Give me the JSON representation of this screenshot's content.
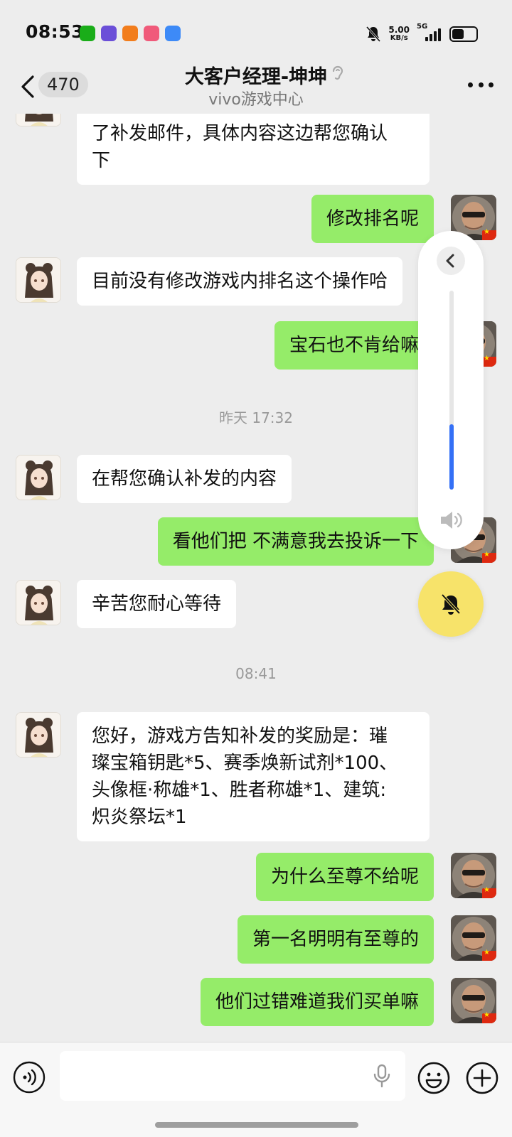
{
  "status_bar": {
    "time": "08:53",
    "net_speed_value": "5.00",
    "net_speed_unit": "KB/s",
    "network": "5G",
    "app_icons": [
      "wechat-icon",
      "sports-app-icon",
      "orange-app-icon",
      "video-app-icon",
      "browser-app-icon"
    ],
    "app_colors": [
      "#1aad19",
      "#6b4fd8",
      "#f27d1c",
      "#f05a7a",
      "#3d8af7"
    ]
  },
  "header": {
    "back_count": "470",
    "title": "大客户经理-坤坤",
    "subtitle": "vivo游戏中心"
  },
  "messages": [
    {
      "side": "in",
      "text": "了补发邮件，具体内容这边帮您确认\n下"
    },
    {
      "side": "out",
      "text": "修改排名呢"
    },
    {
      "side": "in",
      "text": "目前没有修改游戏内排名这个操作哈"
    },
    {
      "side": "out",
      "text": "宝石也不肯给嘛"
    },
    {
      "side": "time",
      "text": "昨天 17:32"
    },
    {
      "side": "in",
      "text": "在帮您确认补发的内容"
    },
    {
      "side": "out",
      "text": "看他们把 不满意我去投诉一下"
    },
    {
      "side": "in",
      "text": "辛苦您耐心等待"
    },
    {
      "side": "time",
      "text": "08:41"
    },
    {
      "side": "in",
      "text": "您好，游戏方告知补发的奖励是：璀\n璨宝箱钥匙*5、赛季焕新试剂*100、\n头像框·称雄*1、胜者称雄*1、建筑:\n炽炎祭坛*1"
    },
    {
      "side": "out",
      "text": "为什么至尊不给呢"
    },
    {
      "side": "out",
      "text": "第一名明明有至尊的"
    },
    {
      "side": "out",
      "text": "他们过错难道我们买单嘛"
    }
  ],
  "volume_panel": {
    "level": 0.33,
    "accent_color": "#3470f6"
  },
  "mute_button": {
    "color": "#f7e36a"
  },
  "colors": {
    "bubble_out": "#95ec69",
    "bubble_in": "#ffffff",
    "background": "#ededed"
  }
}
